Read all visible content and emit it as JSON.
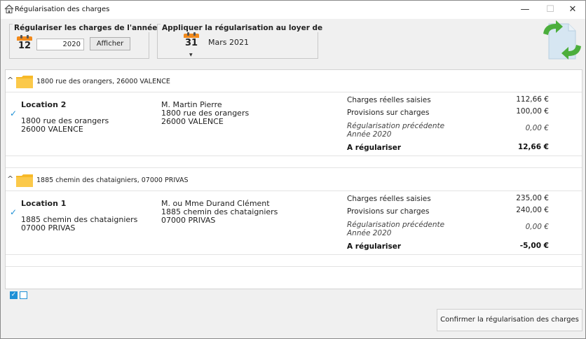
{
  "window": {
    "title": "Régularisation des charges",
    "controls": {
      "minimize": "—",
      "maximize": "☐",
      "close": "✕"
    }
  },
  "filters": {
    "year_group_label": "Régulariser les charges de l'année...",
    "year_calendar_day": "12",
    "year_value": "2020",
    "show_button": "Afficher",
    "apply_group_label": "Appliquer la régularisation au loyer de",
    "apply_calendar_day": "31",
    "apply_month": "Mars 2021"
  },
  "properties": [
    {
      "address": "1800 rue des orangers, 26000 VALENCE",
      "expand_glyph": "^",
      "location": {
        "name": "Location 2",
        "line1": "1800 rue des orangers",
        "line2": "26000 VALENCE",
        "checked": true
      },
      "tenant": {
        "name": "M. Martin Pierre",
        "line1": "1800 rue des orangers",
        "line2": "26000 VALENCE"
      },
      "charges": {
        "real_label": "Charges réelles saisies",
        "real_value": "112,66 €",
        "provisions_label": "Provisions sur charges",
        "provisions_value": "100,00 €",
        "previous_label_1": "Régularisation précédente",
        "previous_label_2": "Année 2020",
        "previous_value": "0,00 €",
        "total_label": "A régulariser",
        "total_value": "12,66 €"
      }
    },
    {
      "address": "1885 chemin des chataigniers, 07000 PRIVAS",
      "expand_glyph": "^",
      "location": {
        "name": "Location 1",
        "line1": "1885 chemin des chataigniers",
        "line2": "07000 PRIVAS",
        "checked": true
      },
      "tenant": {
        "name": "M. ou Mme Durand Clément",
        "line1": "1885 chemin des chataigniers",
        "line2": "07000 PRIVAS"
      },
      "charges": {
        "real_label": "Charges réelles saisies",
        "real_value": "235,00 €",
        "provisions_label": "Provisions sur charges",
        "provisions_value": "240,00 €",
        "previous_label_1": "Régularisation précédente",
        "previous_label_2": "Année 2020",
        "previous_value": "0,00 €",
        "total_label": "A régulariser",
        "total_value": "-5,00 €"
      }
    }
  ],
  "footer": {
    "check_all_glyph": "✓",
    "confirm_button": "Confirmer la régularisation des charges"
  },
  "colors": {
    "accent": "#1e90d6",
    "folder": "#f7b928",
    "calendar": "#f18a1c",
    "refresh_green": "#4cae3c"
  }
}
